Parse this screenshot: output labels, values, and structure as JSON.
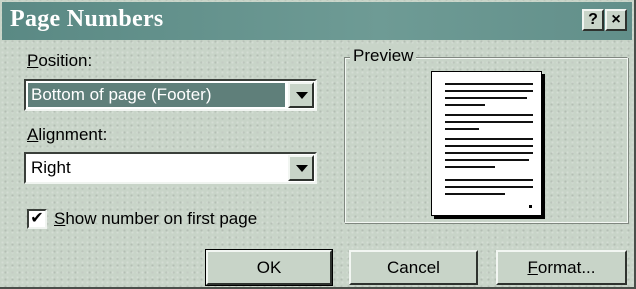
{
  "window": {
    "title": "Page Numbers",
    "help_label": "?",
    "close_label": "×"
  },
  "position": {
    "label_key": "P",
    "label_rest": "osition:",
    "value": "Bottom of page (Footer)"
  },
  "alignment": {
    "label_key": "A",
    "label_rest": "lignment:",
    "value": "Right"
  },
  "first_page": {
    "checked_mark": "✔",
    "label_key": "S",
    "label_rest": "how number on first page",
    "checked": true
  },
  "preview": {
    "label": "Preview"
  },
  "buttons": {
    "ok": "OK",
    "cancel": "Cancel",
    "format_key": "F",
    "format_rest": "ormat..."
  },
  "icons": [
    "help-icon",
    "close-icon",
    "dropdown-arrow-icon",
    "checkmark-icon"
  ],
  "colors": {
    "title_bar": "#5e8d88",
    "dialog_face": "#c8d4c8",
    "selection": "#5f7f7a"
  }
}
